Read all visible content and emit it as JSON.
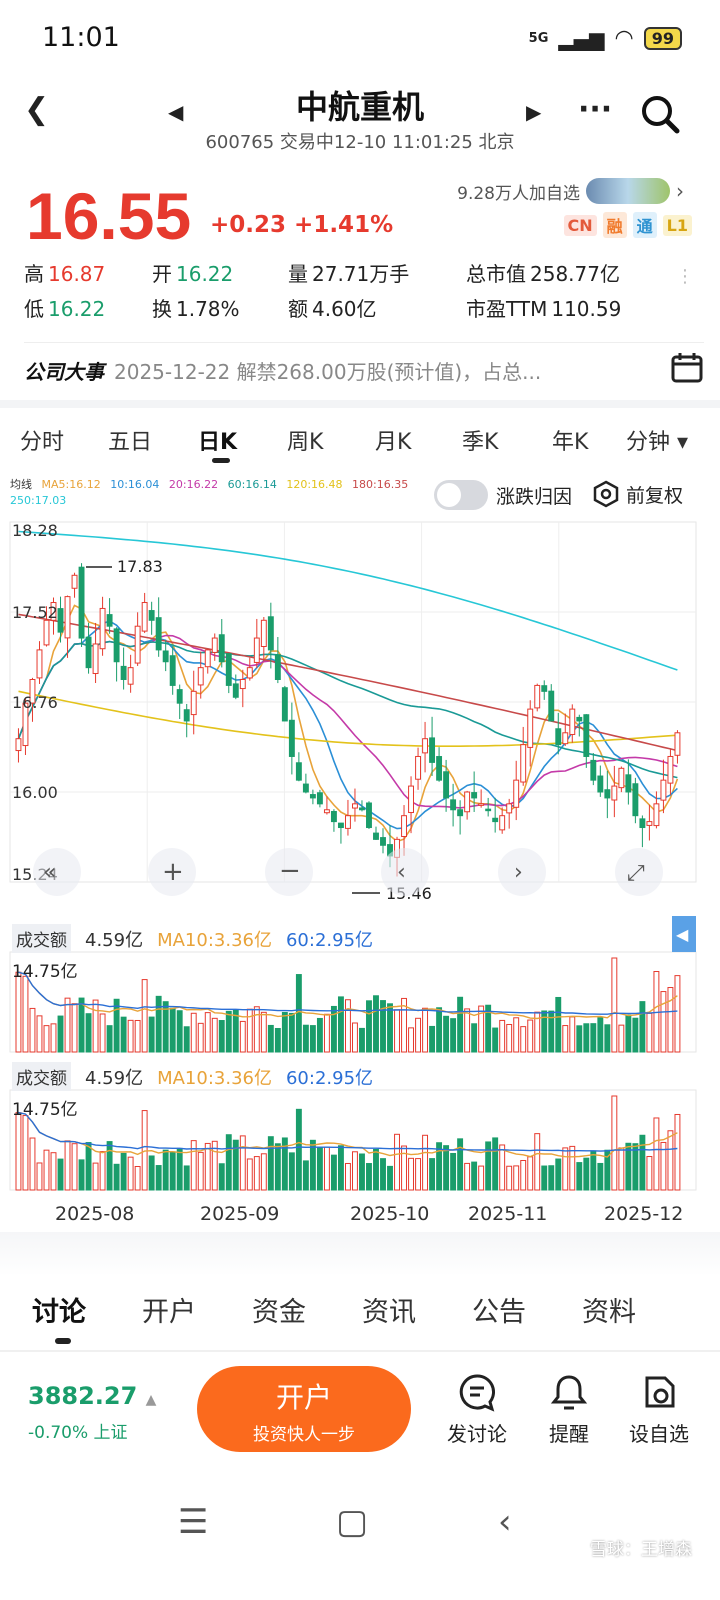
{
  "status": {
    "time": "11:01",
    "signal": "5G",
    "battery": "99"
  },
  "header": {
    "title": "中航重机",
    "subtitle": "600765 交易中12-10 11:01:25 北京"
  },
  "quote": {
    "price": "16.55",
    "change": "+0.23",
    "change_pct": "+1.41%",
    "watchlist": "9.28万人加自选",
    "tags": [
      "CN",
      "融",
      "通",
      "L1"
    ],
    "stats": [
      [
        {
          "label": "高",
          "value": "16.87"
        },
        {
          "label": "开",
          "value": "16.22"
        },
        {
          "label": "量",
          "value": "27.71万手"
        },
        {
          "label": "总市值",
          "value": "258.77亿"
        }
      ],
      [
        {
          "label": "低",
          "value": "16.22"
        },
        {
          "label": "换",
          "value": "1.78%"
        },
        {
          "label": "额",
          "value": "4.60亿"
        },
        {
          "label": "市盈TTM",
          "value": "110.59"
        }
      ]
    ]
  },
  "event": {
    "label": "公司大事",
    "text": "2025-12-22 解禁268.00万股(预计值)，占总..."
  },
  "period_tabs": [
    "分时",
    "五日",
    "日K",
    "周K",
    "月K",
    "季K",
    "年K",
    "分钟 ▾"
  ],
  "active_period": "日K",
  "ma_legend": {
    "label": "均线",
    "items": [
      {
        "text": "MA5:16.12",
        "color": "#e8a33a"
      },
      {
        "text": "10:16.04",
        "color": "#2b8fd6"
      },
      {
        "text": "20:16.22",
        "color": "#c43aa8"
      },
      {
        "text": "60:16.14",
        "color": "#1a9a96"
      },
      {
        "text": "120:16.48",
        "color": "#e3c21b"
      },
      {
        "text": "180:16.35",
        "color": "#c74a4a"
      },
      {
        "text": "250:17.03",
        "color": "#27c7d6"
      }
    ]
  },
  "toggle_label": "涨跌归因",
  "adjust_label": "前复权",
  "chart_data": {
    "type": "candlestick",
    "y_ticks": [
      "18.28",
      "17.52",
      "16.76",
      "16.00",
      "15.24"
    ],
    "ylim": [
      15.24,
      18.28
    ],
    "max_label": "17.83",
    "min_label": "15.46",
    "x_labels": [
      "2025-08",
      "2025-09",
      "2025-10",
      "2025-11",
      "2025-12"
    ],
    "up_color": "#e63a2e",
    "down_color": "#1a9d6b",
    "candles_approx": [
      16.45,
      16.75,
      16.95,
      17.2,
      17.45,
      17.6,
      17.35,
      17.65,
      17.83,
      17.3,
      17.05,
      17.25,
      17.55,
      17.4,
      17.1,
      16.95,
      17.05,
      17.4,
      17.6,
      17.45,
      17.2,
      17.1,
      16.9,
      16.75,
      16.6,
      16.85,
      17.05,
      17.2,
      17.3,
      17.1,
      16.9,
      16.8,
      16.95,
      17.05,
      17.3,
      17.45,
      17.2,
      16.95,
      16.6,
      16.3,
      16.1,
      16.0,
      15.95,
      15.9,
      15.85,
      15.75,
      15.7,
      15.8,
      15.9,
      15.85,
      15.7,
      15.6,
      15.55,
      15.46,
      15.6,
      15.8,
      16.05,
      16.3,
      16.45,
      16.25,
      16.1,
      15.95,
      15.85,
      15.8,
      16.0,
      15.95,
      15.9,
      15.85,
      15.75,
      15.8,
      15.9,
      16.1,
      16.4,
      16.7,
      16.9,
      16.85,
      16.6,
      16.4,
      16.5,
      16.7,
      16.6,
      16.3,
      16.1,
      16.0,
      15.95,
      16.05,
      16.2,
      16.0,
      15.8,
      15.7,
      15.75,
      15.9,
      16.1,
      16.3,
      16.5
    ],
    "volume_panels": [
      {
        "label": "成交额",
        "value": "4.59亿",
        "ma10": "MA10:3.36亿",
        "ma60": "60:2.95亿",
        "top": "14.75亿"
      },
      {
        "label": "成交额",
        "value": "4.59亿",
        "ma10": "MA10:3.36亿",
        "ma60": "60:2.95亿",
        "top": "14.75亿"
      }
    ]
  },
  "bottom_tabs": [
    "讨论",
    "开户",
    "资金",
    "资讯",
    "公告",
    "资料"
  ],
  "index": {
    "value": "3882.27",
    "sub": "-0.70% 上证"
  },
  "open_account": {
    "title": "开户",
    "subtitle": "投资快人一步"
  },
  "actions": [
    {
      "label": "发讨论",
      "icon": "chat-icon"
    },
    {
      "label": "提醒",
      "icon": "bell-icon"
    },
    {
      "label": "设自选",
      "icon": "watchlist-icon"
    }
  ],
  "watermark": "雪球：王增森"
}
